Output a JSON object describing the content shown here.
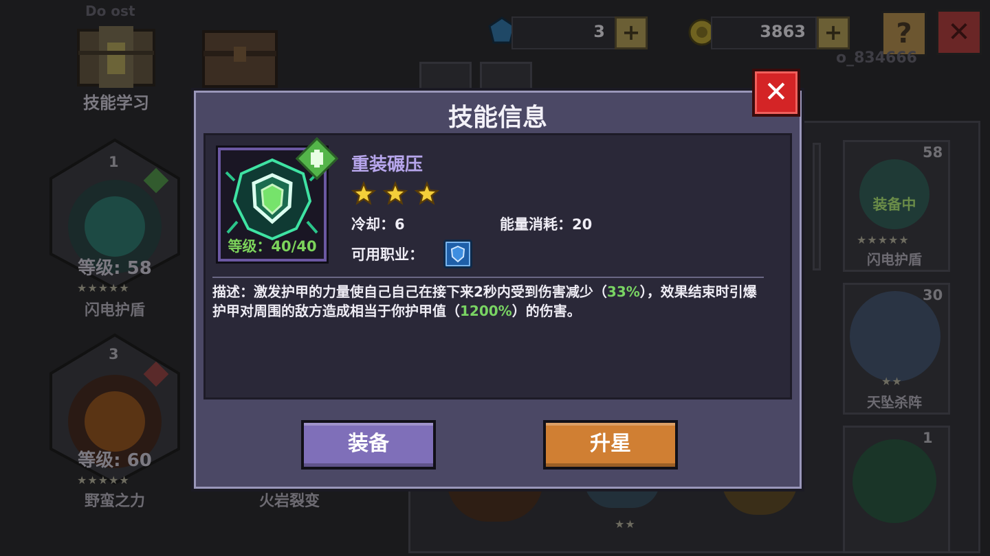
{
  "header": {
    "gem_count": "3",
    "gold_count": "3863",
    "help_label": "?",
    "close_label": "✕",
    "player_id_partial": "o_834666",
    "top_left_faded": "Do  ost"
  },
  "background": {
    "skill_learn_label": "技能学习",
    "left_skills": [
      {
        "rank": "1",
        "level": "等级: 58",
        "stars": "★★★★★",
        "name": "闪电护盾"
      },
      {
        "rank": "3",
        "level": "等级: 60",
        "stars": "★★★★★",
        "name": "野蛮之力"
      }
    ],
    "middle_skill_name": "火岩裂变",
    "right_cards": [
      {
        "count": "58",
        "overlay": "装备中",
        "stars": "★★★★★",
        "name": "闪电护盾"
      },
      {
        "count": "30",
        "stars": "★★",
        "name": "天坠杀阵"
      },
      {
        "count": "1"
      }
    ],
    "bottom_stars": "★★"
  },
  "dialog": {
    "title": "技能信息",
    "close_label": "✕",
    "skill": {
      "name": "重装碾压",
      "star_count": 3,
      "level_label": "等级：40/40",
      "cooldown_label": "冷却：6",
      "energy_label": "能量消耗：20",
      "class_label": "可用职业：",
      "class_icon": "shield-class-icon",
      "desc_prefix": "描述：激发护甲的力量使自己自己在接下来2秒内受到伤害减少（",
      "desc_hl1": "33%",
      "desc_mid": "），效果结束时引爆护甲对周围的敌方造成相当于你护甲值（",
      "desc_hl2": "1200%",
      "desc_suffix": "）的伤害。"
    },
    "buttons": {
      "equip": "装备",
      "upgrade": "升星"
    }
  },
  "colors": {
    "dialog_bg": "#4b4865",
    "highlight": "#79d463",
    "skill_name": "#b7a6ec",
    "equip_button": "#7f6fb9",
    "upgrade_button": "#d07f33",
    "close_button": "#d42426"
  }
}
